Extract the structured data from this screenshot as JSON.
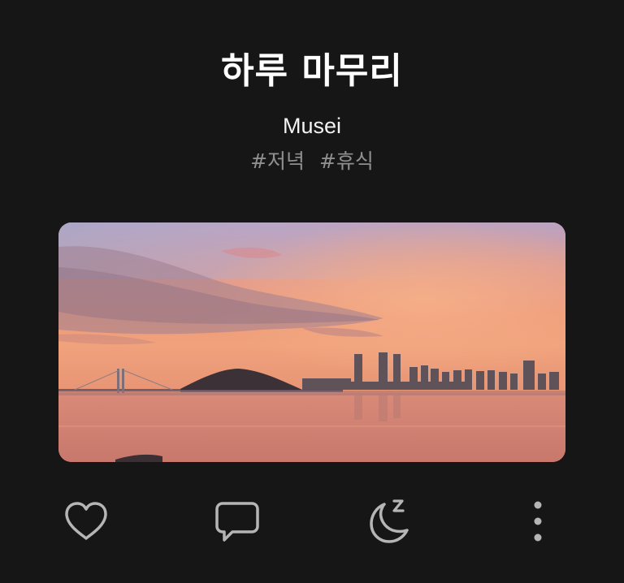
{
  "post": {
    "title": "하루 마무리",
    "author": "Musei",
    "tags": [
      "#저녁",
      "#휴식"
    ]
  },
  "actions": {
    "icons": [
      "heart-icon",
      "comment-icon",
      "sleep-moon-icon",
      "more-vertical-icon"
    ]
  },
  "colors": {
    "background": "#161616",
    "title": "#ffffff",
    "tag": "#8f8f8f",
    "icon": "#b5b5b5"
  }
}
